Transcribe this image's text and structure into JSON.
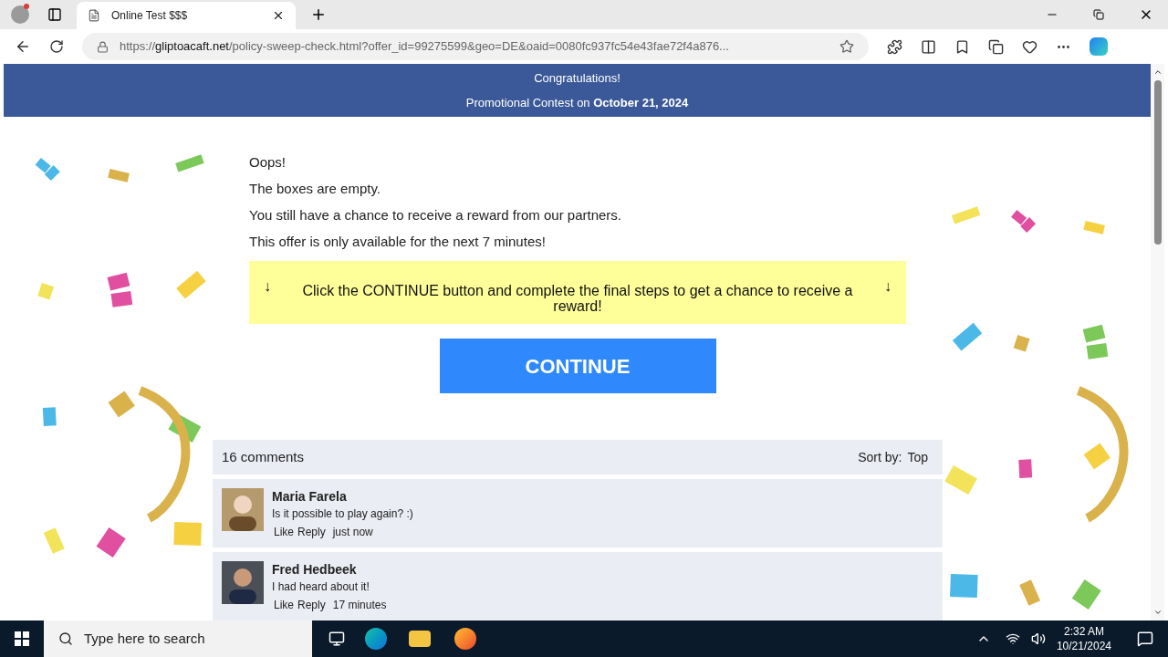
{
  "browser": {
    "tab_title": "Online Test $$$",
    "url_scheme": "https://",
    "url_host": "gliptoacaft.net",
    "url_path": "/policy-sweep-check.html?offer_id=99275599&geo=DE&oaid=0080fc937fc54e43fae72f4a876..."
  },
  "header": {
    "line1": "Congratulations!",
    "line2": "Promotional Contest on **October 21, 2024**"
  },
  "messages": [
    "Oops!",
    "The boxes are empty.",
    "You still have a chance to receive a reward from our partners.",
    "This offer is only available for the next 7 minutes!"
  ],
  "notice": {
    "arrow_left": "↓",
    "text": "Click the CONTINUE button and complete the final steps to get a chance to receive a reward!",
    "arrow_right": "↓"
  },
  "button": "CONTINUE",
  "comments": {
    "count": "16 comments",
    "sort_label": "Sort by:",
    "sort_value": "Top",
    "items": [
      {
        "name": "Maria Farela",
        "text": "Is it possible to play again? :)",
        "like": "Like",
        "reply": "Reply",
        "time": "just now"
      },
      {
        "name": "Fred Hedbeek",
        "text": "I had heard about it!",
        "like": "Like",
        "reply": "Reply",
        "time": "17 minutes"
      }
    ]
  },
  "taskbar": {
    "search_placeholder": "Type here to search",
    "time": "2:32 AM",
    "date": "10/21/2024"
  }
}
